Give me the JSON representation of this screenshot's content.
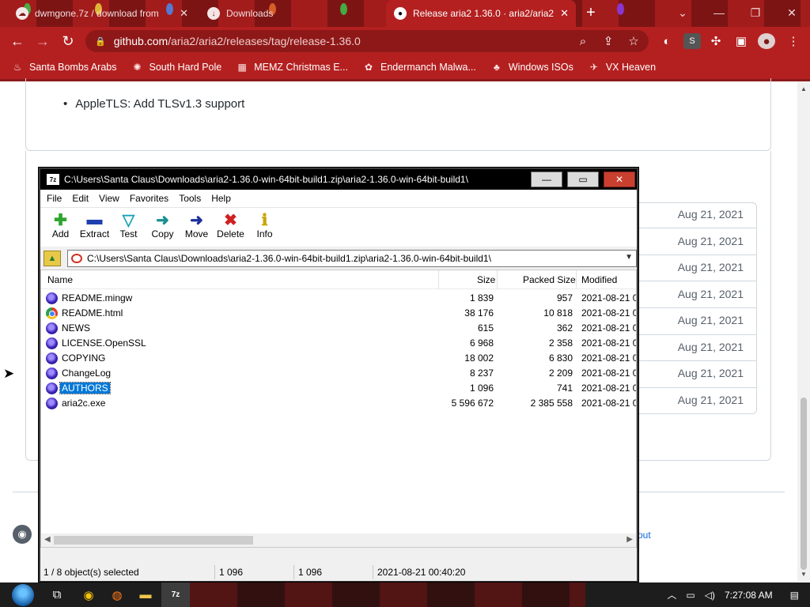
{
  "browser": {
    "tabs": [
      {
        "title": "dwmgone.7z / download from",
        "active": false
      },
      {
        "title": "Downloads",
        "active": false
      },
      {
        "title": "Release aria2 1.36.0 · aria2/aria2",
        "active": true
      }
    ],
    "new_tab_label": "+",
    "address": {
      "domain": "github.com",
      "path": "/aria2/aria2/releases/tag/release-1.36.0"
    },
    "profile_badge": "S",
    "bookmarks": [
      {
        "label": "Santa Bombs Arabs",
        "icon": "bookmark-icon"
      },
      {
        "label": "South Hard Pole",
        "icon": "bookmark-icon"
      },
      {
        "label": "MEMZ Christmas E...",
        "icon": "bookmark-icon"
      },
      {
        "label": "Endermanch Malwa...",
        "icon": "bookmark-icon"
      },
      {
        "label": "Windows ISOs",
        "icon": "bookmark-icon"
      },
      {
        "label": "VX Heaven",
        "icon": "bookmark-icon"
      }
    ]
  },
  "github": {
    "bullet": "AppleTLS: Add TLSv1.3 support",
    "asset_dates": [
      "Aug 21, 2021",
      "Aug 21, 2021",
      "Aug 21, 2021",
      "Aug 21, 2021",
      "Aug 21, 2021",
      "Aug 21, 2021",
      "Aug 21, 2021",
      "Aug 21, 2021"
    ],
    "footer_link": "out"
  },
  "zip": {
    "title": "C:\\Users\\Santa Claus\\Downloads\\aria2-1.36.0-win-64bit-build1.zip\\aria2-1.36.0-win-64bit-build1\\",
    "menu": [
      "File",
      "Edit",
      "View",
      "Favorites",
      "Tools",
      "Help"
    ],
    "tools": [
      {
        "label": "Add",
        "icon": "add-icon",
        "color": "#2fa52f",
        "glyph": "✚"
      },
      {
        "label": "Extract",
        "icon": "extract-icon",
        "color": "#1f3fb0",
        "glyph": "▬"
      },
      {
        "label": "Test",
        "icon": "test-icon",
        "color": "#1aa5b5",
        "glyph": "▽"
      },
      {
        "label": "Copy",
        "icon": "copy-icon",
        "color": "#1a8f8f",
        "glyph": "➜"
      },
      {
        "label": "Move",
        "icon": "move-icon",
        "color": "#1c2f9c",
        "glyph": "➜"
      },
      {
        "label": "Delete",
        "icon": "delete-icon",
        "color": "#d02020",
        "glyph": "✖"
      },
      {
        "label": "Info",
        "icon": "info-icon",
        "color": "#c9a400",
        "glyph": "ℹ"
      }
    ],
    "path": "C:\\Users\\Santa Claus\\Downloads\\aria2-1.36.0-win-64bit-build1.zip\\aria2-1.36.0-win-64bit-build1\\",
    "columns": {
      "name": "Name",
      "size": "Size",
      "packed": "Packed Size",
      "modified": "Modified"
    },
    "files": [
      {
        "name": "README.mingw",
        "size": "1 839",
        "packed": "957",
        "modified": "2021-08-21 0",
        "icon": "aria-icon",
        "selected": false
      },
      {
        "name": "README.html",
        "size": "38 176",
        "packed": "10 818",
        "modified": "2021-08-21 0",
        "icon": "chrome-icon",
        "selected": false
      },
      {
        "name": "NEWS",
        "size": "615",
        "packed": "362",
        "modified": "2021-08-21 0",
        "icon": "aria-icon",
        "selected": false
      },
      {
        "name": "LICENSE.OpenSSL",
        "size": "6 968",
        "packed": "2 358",
        "modified": "2021-08-21 0",
        "icon": "aria-icon",
        "selected": false
      },
      {
        "name": "COPYING",
        "size": "18 002",
        "packed": "6 830",
        "modified": "2021-08-21 0",
        "icon": "aria-icon",
        "selected": false
      },
      {
        "name": "ChangeLog",
        "size": "8 237",
        "packed": "2 209",
        "modified": "2021-08-21 0",
        "icon": "aria-icon",
        "selected": false
      },
      {
        "name": "AUTHORS",
        "size": "1 096",
        "packed": "741",
        "modified": "2021-08-21 0",
        "icon": "aria-icon",
        "selected": true
      },
      {
        "name": "aria2c.exe",
        "size": "5 596 672",
        "packed": "2 385 558",
        "modified": "2021-08-21 0",
        "icon": "aria-icon",
        "selected": false
      }
    ],
    "status": {
      "selection": "1 / 8 object(s) selected",
      "size": "1 096",
      "packed": "1 096",
      "modified": "2021-08-21 00:40:20"
    }
  },
  "taskbar": {
    "clock": "7:27:08 AM",
    "apps": [
      "start-orb",
      "task-view",
      "chrome",
      "firefox",
      "file-explorer",
      "7zip"
    ]
  }
}
